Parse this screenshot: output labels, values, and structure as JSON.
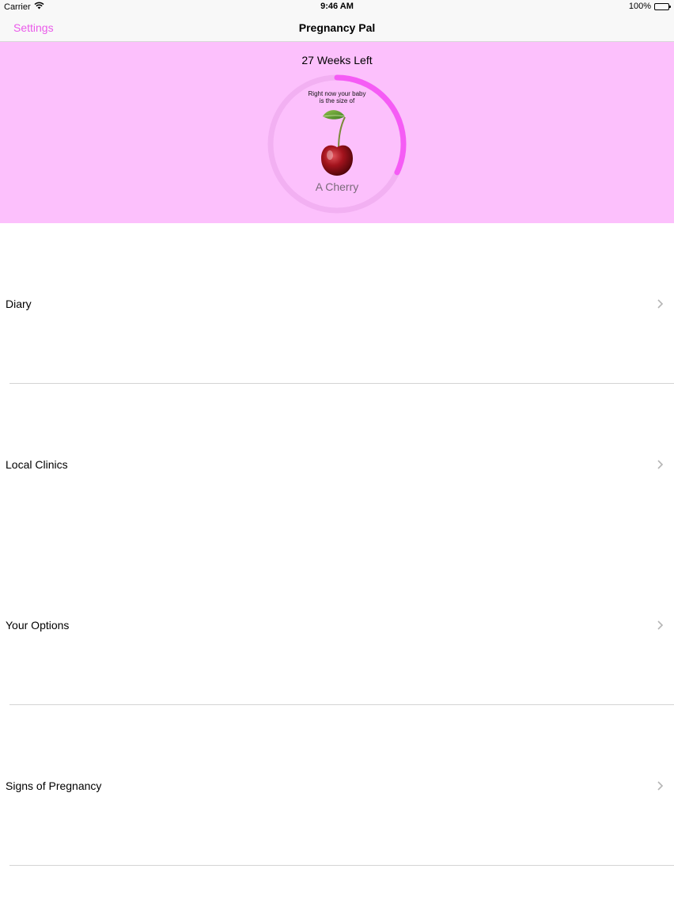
{
  "status_bar": {
    "carrier": "Carrier",
    "time": "9:46 AM",
    "battery": "100%"
  },
  "nav": {
    "left_button": "Settings",
    "title": "Pregnancy Pal"
  },
  "hero": {
    "weeks_left": "27 Weeks Left",
    "caption_line1": "Right now your baby",
    "caption_line2": "is the size of",
    "fruit_icon": "cherry-icon",
    "fruit_name": "A Cherry",
    "progress_fraction": 0.32,
    "colors": {
      "background": "#fcc0fc",
      "ring_track": "#f2b0f2",
      "ring_progress": "#f55cf5"
    }
  },
  "menu": {
    "items": [
      {
        "label": "Diary"
      },
      {
        "label": "Local Clinics"
      },
      {
        "label": "Your Options"
      },
      {
        "label": "Signs of Pregnancy"
      }
    ]
  },
  "colors": {
    "accent": "#ea5bea"
  }
}
